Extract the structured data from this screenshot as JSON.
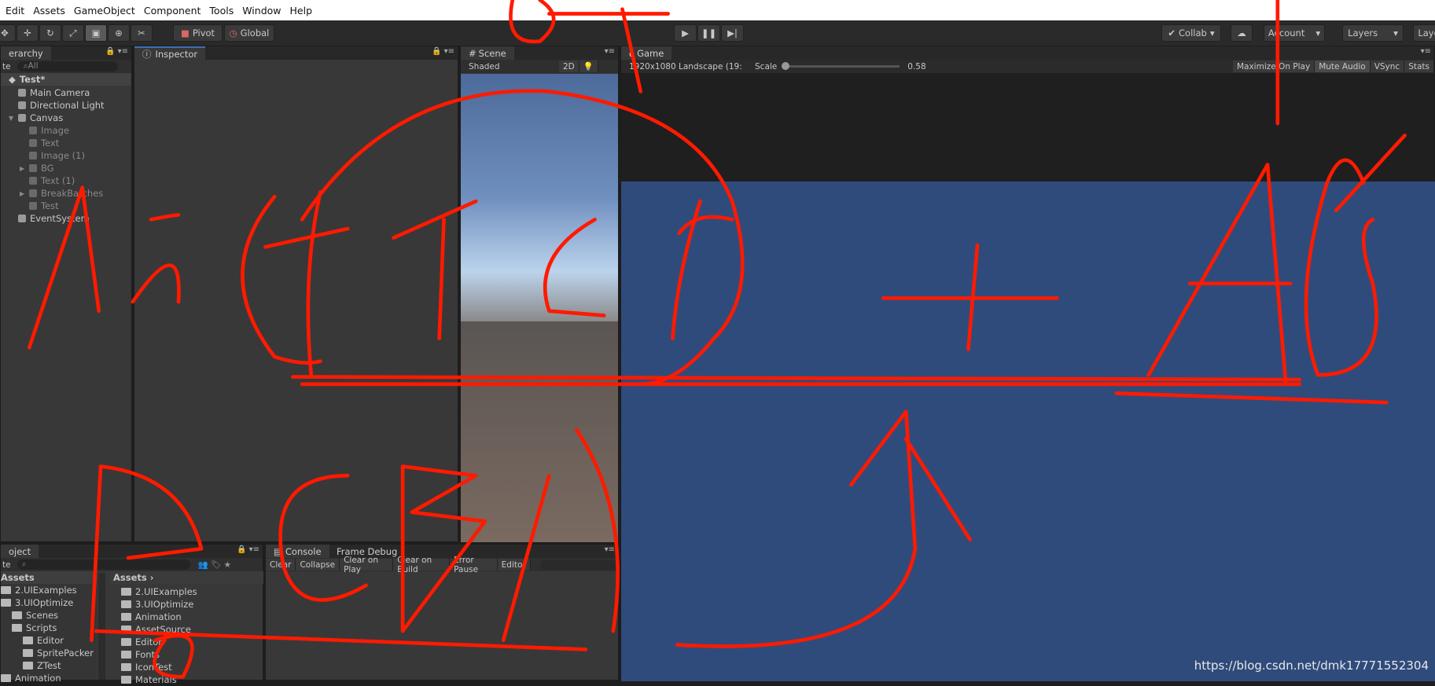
{
  "menu": [
    "Edit",
    "Assets",
    "GameObject",
    "Component",
    "Tools",
    "Window",
    "Help"
  ],
  "toolbar": {
    "tools": [
      "hand",
      "move",
      "rotate",
      "scale",
      "rect",
      "transform",
      "custom"
    ],
    "pivot": "Pivot",
    "global": "Global",
    "play_icons": [
      "play-icon",
      "pause-icon",
      "step-icon"
    ],
    "collab": "Collab",
    "account": "Account",
    "layers": "Layers",
    "layout": "Layo"
  },
  "hierarchy": {
    "tab": "erarchy",
    "create": "te",
    "search_placeholder": "All",
    "scene": "Test*",
    "items": [
      {
        "label": "Main Camera",
        "indent": 0,
        "dim": false,
        "arrow": ""
      },
      {
        "label": "Directional Light",
        "indent": 0,
        "dim": false,
        "arrow": ""
      },
      {
        "label": "Canvas",
        "indent": 0,
        "dim": false,
        "arrow": "▼"
      },
      {
        "label": "Image",
        "indent": 1,
        "dim": true,
        "arrow": ""
      },
      {
        "label": "Text",
        "indent": 1,
        "dim": true,
        "arrow": ""
      },
      {
        "label": "Image (1)",
        "indent": 1,
        "dim": true,
        "arrow": ""
      },
      {
        "label": "BG",
        "indent": 1,
        "dim": true,
        "arrow": "▶"
      },
      {
        "label": "Text (1)",
        "indent": 1,
        "dim": true,
        "arrow": ""
      },
      {
        "label": "BreakBatches",
        "indent": 1,
        "dim": true,
        "arrow": "▶"
      },
      {
        "label": "Test",
        "indent": 1,
        "dim": true,
        "arrow": ""
      },
      {
        "label": "EventSystem",
        "indent": 0,
        "dim": false,
        "arrow": ""
      }
    ]
  },
  "inspector": {
    "tab": "Inspector"
  },
  "scene": {
    "tab": "Scene",
    "shading": "Shaded",
    "mode2d": "2D"
  },
  "game": {
    "tab": "Game",
    "resolution": "1920x1080 Landscape (19:",
    "scale_label": "Scale",
    "scale_value": "0.58",
    "scale_fraction": 0.0,
    "toggles": [
      "Maximize On Play",
      "Mute Audio",
      "VSync",
      "Stats"
    ],
    "background": "#2f4b7c"
  },
  "project": {
    "tab": "oject",
    "create": "te",
    "tree_header": "Assets",
    "tree": [
      {
        "label": "2.UIExamples",
        "indent": 0
      },
      {
        "label": "3.UIOptimize",
        "indent": 0
      },
      {
        "label": "Scenes",
        "indent": 1
      },
      {
        "label": "Scripts",
        "indent": 1
      },
      {
        "label": "Editor",
        "indent": 2
      },
      {
        "label": "SpritePacker",
        "indent": 2
      },
      {
        "label": "ZTest",
        "indent": 2
      },
      {
        "label": "Animation",
        "indent": 0
      }
    ],
    "breadcrumb": "Assets",
    "assets": [
      "2.UIExamples",
      "3.UIOptimize",
      "Animation",
      "AssetSource",
      "Editor",
      "Fonts",
      "IconTest",
      "Materials"
    ]
  },
  "console": {
    "tab": "Console",
    "tab2": "Frame Debug",
    "buttons": [
      "Clear",
      "Collapse",
      "Clear on Play",
      "Clear on Build",
      "Error Pause",
      "Editor"
    ]
  },
  "watermark": "https://blog.csdn.net/dmk17771552304",
  "annotation_color": "#ff1a00"
}
